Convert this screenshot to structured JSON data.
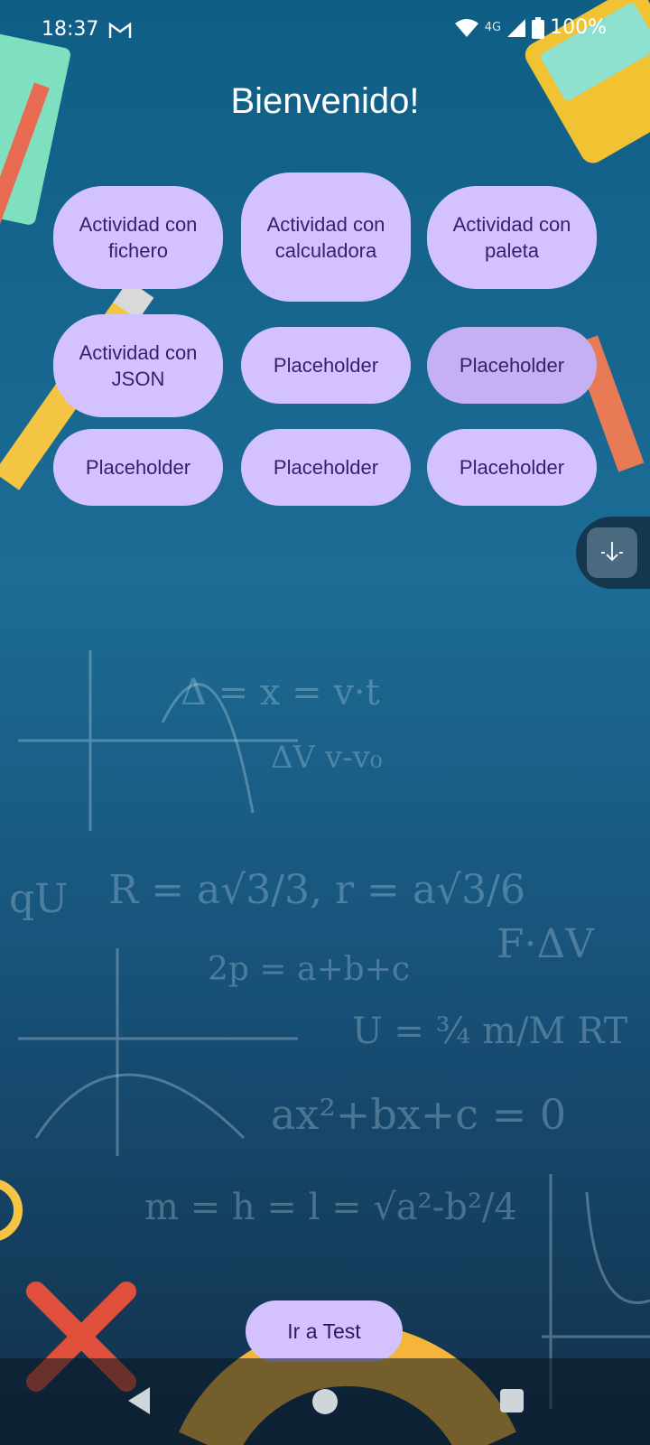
{
  "status": {
    "time": "18:37",
    "network": "4G",
    "battery": "100%"
  },
  "header": {
    "title": "Bienvenido!"
  },
  "buttons": [
    {
      "label": "Actividad con fichero"
    },
    {
      "label": "Actividad con calculadora"
    },
    {
      "label": "Actividad con paleta"
    },
    {
      "label": "Actividad con JSON"
    },
    {
      "label": "Placeholder"
    },
    {
      "label": "Placeholder"
    },
    {
      "label": "Placeholder"
    },
    {
      "label": "Placeholder"
    },
    {
      "label": "Placeholder"
    }
  ],
  "footer": {
    "test_button": "Ir a Test"
  },
  "colors": {
    "button_bg": "#d3c2ff",
    "button_text": "#3a1d6e",
    "background": "#1c6c95"
  }
}
